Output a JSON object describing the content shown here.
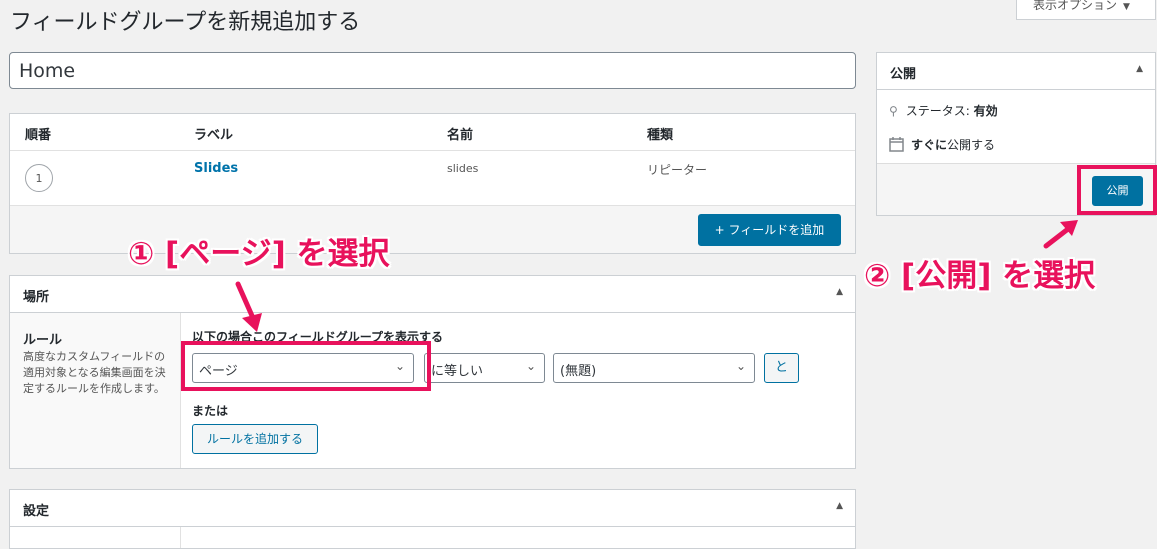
{
  "page": {
    "title": "フィールドグループを新規追加する",
    "screen_options": "表示オプション"
  },
  "title_input": {
    "value": "Home"
  },
  "fields": {
    "headers": {
      "order": "順番",
      "label": "ラベル",
      "name": "名前",
      "type": "種類"
    },
    "rows": [
      {
        "order": "1",
        "label": "Slides",
        "name": "slides",
        "type": "リピーター"
      }
    ],
    "add_button": "+ フィールドを追加"
  },
  "location": {
    "title": "場所",
    "rules_title": "ルール",
    "rules_desc": "高度なカスタムフィールドの適用対象となる編集画面を決定するルールを作成します。",
    "show_if_label": "以下の場合このフィールドグループを表示する",
    "param_select": "ページ",
    "operator_select": "に等しい",
    "value_select": "(無題)",
    "and_button": "と",
    "or_label": "または",
    "add_rule_button": "ルールを追加する"
  },
  "settings": {
    "title": "設定"
  },
  "publish": {
    "title": "公開",
    "status_label": "ステータス:",
    "status_value": "有効",
    "schedule_label": "すぐに",
    "schedule_text": "公開する",
    "publish_button": "公開"
  },
  "annotations": {
    "step1": "① [ページ] を選択",
    "step2": "② [公開] を選択",
    "color": "#e8125c"
  }
}
